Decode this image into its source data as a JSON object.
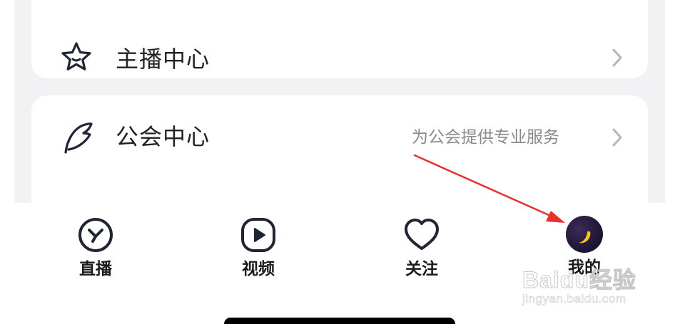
{
  "menu": {
    "items": [
      {
        "label": "主播中心",
        "subtitle": "",
        "icon": "star-icon"
      },
      {
        "label": "公会中心",
        "subtitle": "为公会提供专业服务",
        "icon": "feather-icon"
      }
    ]
  },
  "tabbar": {
    "tabs": [
      {
        "label": "直播",
        "icon": "live-icon"
      },
      {
        "label": "视频",
        "icon": "play-icon"
      },
      {
        "label": "关注",
        "icon": "heart-icon"
      },
      {
        "label": "我的",
        "icon": "avatar"
      }
    ]
  },
  "watermark": {
    "brand": "Baidu经验",
    "url": "jingyan.baidu.com"
  },
  "colors": {
    "background_gray": "#f2f2f5",
    "text_primary": "#222222",
    "text_secondary": "#8a8a8a",
    "annotation_arrow": "#e8312d",
    "avatar_moon": "#f5c518"
  }
}
